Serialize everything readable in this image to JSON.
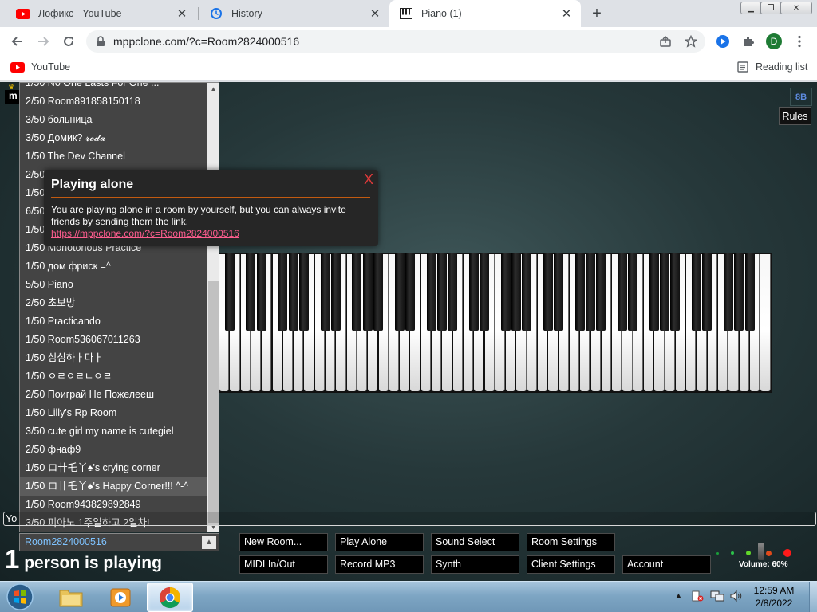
{
  "browser": {
    "tabs": [
      {
        "title": "Лофикс - YouTube",
        "favicon": "youtube-icon"
      },
      {
        "title": "History",
        "favicon": "history-icon"
      },
      {
        "title": "Piano (1)",
        "favicon": "piano-icon",
        "active": true
      }
    ],
    "address": "mppclone.com/?c=Room2824000516",
    "profile_initial": "D",
    "bookmarks": [
      {
        "label": "YouTube",
        "icon": "youtube-icon"
      }
    ],
    "reading_list_label": "Reading list"
  },
  "room_list": {
    "items": [
      "1/50 No One Lasts For One ...",
      "2/50 Room891858150118",
      "3/50 больница",
      "3/50 Домик? 𝓻𝓮𝓭𝓪",
      "1/50 The Dev Channel",
      "2/50",
      "1/50",
      "6/50",
      "1/50",
      "1/50 Monotonous Practice",
      "1/50 дом фриск =^",
      "5/50 Piano",
      "2/50 초보방",
      "1/50 Practicando",
      "1/50 Room536067011263",
      "1/50 심심하ㅏ다ㅏ",
      "1/50 ㅇㄹㅇㄹㄴㅇㄹ",
      "2/50 Поиграй Не Пожелееш",
      "1/50 Lilly's Rp Room",
      "3/50 cute girl my name is cutegiel",
      "2/50 фнаф9",
      "1/50 ロ卄乇丫♠'s crying corner",
      "1/50 ロ卄乇丫♠'s Happy Corner!!! ^-^",
      "1/50 Room943829892849",
      "3/50 피아노 1주일하고 2일차!"
    ],
    "highlighted_index": 22,
    "current_room": "Room2824000516"
  },
  "notification": {
    "title": "Playing alone",
    "close": "X",
    "body": "You are playing alone in a room by yourself, but you can always invite friends by sending them the link.",
    "link": "https://mppclone.com/?c=Room2824000516"
  },
  "top_right": {
    "badge": "8B",
    "rules": "Rules"
  },
  "user_tag": "m",
  "chat_prefix": "Yo",
  "status": {
    "count": "1",
    "text": "person is playing"
  },
  "controls": {
    "row1": [
      "New Room...",
      "Play Alone",
      "Sound Select",
      "Room Settings"
    ],
    "row2": [
      "MIDI In/Out",
      "Record MP3",
      "Synth",
      "Client Settings",
      "Account"
    ]
  },
  "volume_label": "Volume: 60%",
  "volume": 0.6,
  "taskbar": {
    "apps": [
      "file-explorer-icon",
      "media-player-icon",
      "chrome-icon"
    ],
    "time": "12:59 AM",
    "date": "2/8/2022"
  },
  "colors": {
    "page_bg": "#26383a",
    "link": "#ff5d8f",
    "current_room": "#7fc3ff",
    "close": "#e03a3a"
  }
}
